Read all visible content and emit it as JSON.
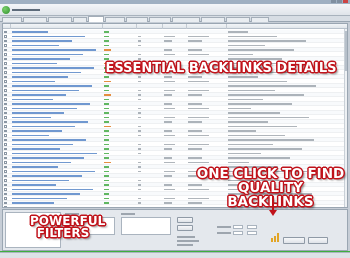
{
  "overlays": {
    "details": "ESSENTIAL BACKLINKS DETAILS",
    "one_click_line1": "ONE CLICK TO FIND",
    "one_click_line2": "QUALITY BACKLINKS",
    "filters_line1": "POWERFUL",
    "filters_line2": "FILTERS"
  },
  "colors": {
    "overlay_text": "#ffffff",
    "overlay_outline": "#c0121a",
    "link_text": "#4d7fc4",
    "dofollow_yes": "#3aa63a",
    "nofollow": "#e07a1e",
    "progress": "#3fae3f"
  },
  "icons": {
    "app_logo": "globe-icon",
    "export_button": "bar-chart-icon"
  },
  "progress": {
    "value": 1.0
  }
}
